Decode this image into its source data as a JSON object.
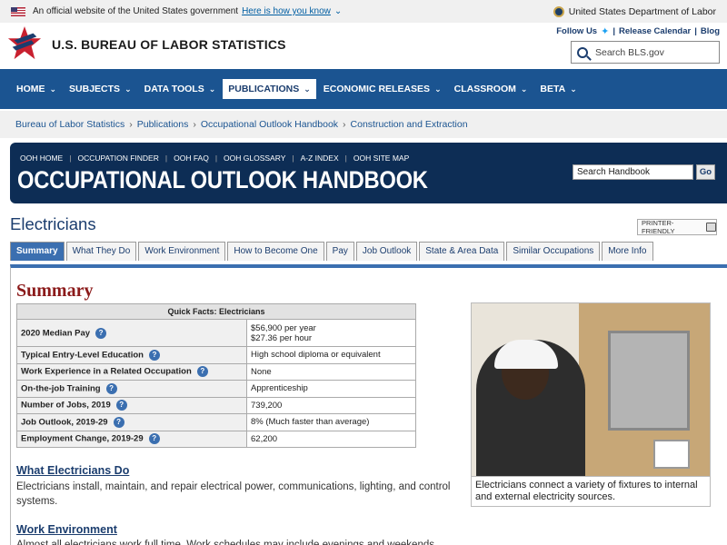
{
  "gov_banner": {
    "text": "An official website of the United States government",
    "link": "Here is how you know",
    "department": "United States Department of Labor"
  },
  "header": {
    "site_title": "U.S. BUREAU OF LABOR STATISTICS",
    "follow_us": "Follow Us",
    "release_calendar": "Release Calendar",
    "blog": "Blog",
    "search_placeholder": "Search BLS.gov"
  },
  "main_nav": [
    {
      "label": "HOME"
    },
    {
      "label": "SUBJECTS"
    },
    {
      "label": "DATA TOOLS"
    },
    {
      "label": "PUBLICATIONS",
      "active": true
    },
    {
      "label": "ECONOMIC RELEASES"
    },
    {
      "label": "CLASSROOM"
    },
    {
      "label": "BETA"
    }
  ],
  "breadcrumb": [
    "Bureau of Labor Statistics",
    "Publications",
    "Occupational Outlook Handbook",
    "Construction and Extraction"
  ],
  "ooh": {
    "links": [
      "OOH HOME",
      "OCCUPATION FINDER",
      "OOH FAQ",
      "OOH GLOSSARY",
      "A-Z INDEX",
      "OOH SITE MAP"
    ],
    "title": "OCCUPATIONAL OUTLOOK HANDBOOK",
    "search_value": "Search Handbook",
    "go_label": "Go"
  },
  "occupation": {
    "title": "Electricians",
    "printer_label": "PRINTER-FRIENDLY"
  },
  "tabs": [
    "Summary",
    "What They Do",
    "Work Environment",
    "How to Become One",
    "Pay",
    "Job Outlook",
    "State & Area Data",
    "Similar Occupations",
    "More Info"
  ],
  "summary": {
    "heading": "Summary",
    "quick_facts_title": "Quick Facts: Electricians",
    "rows": [
      {
        "label": "2020 Median Pay",
        "value": "$56,900 per year",
        "value2": "$27.36 per hour"
      },
      {
        "label": "Typical Entry-Level Education",
        "value": "High school diploma or equivalent"
      },
      {
        "label": "Work Experience in a Related Occupation",
        "value": "None"
      },
      {
        "label": "On-the-job Training",
        "value": "Apprenticeship"
      },
      {
        "label": "Number of Jobs, 2019",
        "value": "739,200"
      },
      {
        "label": "Job Outlook, 2019-29",
        "value": "8% (Much faster than average)"
      },
      {
        "label": "Employment Change, 2019-29",
        "value": "62,200"
      }
    ],
    "photo_caption": "Electricians connect a variety of fixtures to internal and external electricity sources.",
    "what_heading": "What Electricians Do",
    "what_text": "Electricians install, maintain, and repair electrical power, communications, lighting, and control systems.",
    "work_env_heading": "Work Environment",
    "work_env_text": "Almost all electricians work full time. Work schedules may include evenings and weekends. Overtime is"
  }
}
